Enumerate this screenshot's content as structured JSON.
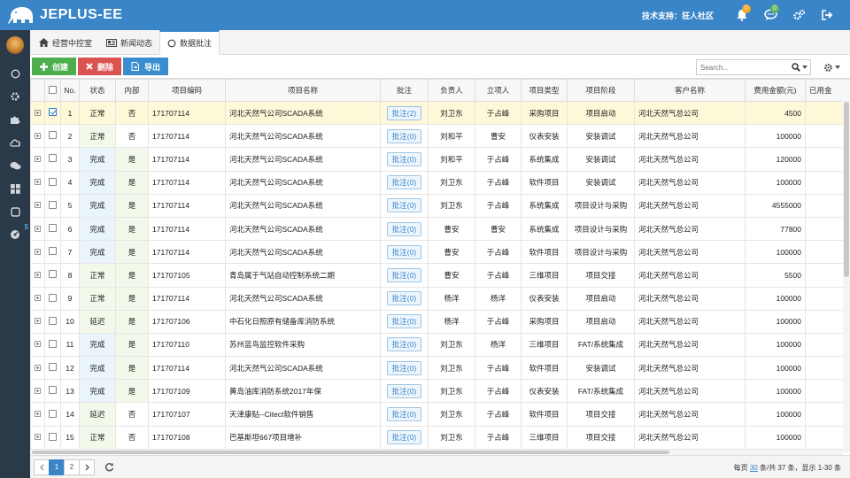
{
  "app": {
    "name": "JEPLUS-EE",
    "support": "技术支持：狂人社区"
  },
  "header": {
    "notify_count": "0",
    "message_count": "0"
  },
  "sidebar": {
    "badge": "5"
  },
  "tabs": [
    {
      "label": "经营中控室"
    },
    {
      "label": "新闻动态"
    },
    {
      "label": "数据批注"
    }
  ],
  "toolbar": {
    "create": "创建",
    "delete": "删除",
    "export": "导出",
    "search_placeholder": "Search..."
  },
  "columns": [
    "No.",
    "状态",
    "内部",
    "项目编码",
    "项目名称",
    "批注",
    "负责人",
    "立项人",
    "项目类型",
    "项目阶段",
    "客户名称",
    "费用金额(元)",
    "已用金"
  ],
  "rows": [
    {
      "no": "1",
      "status": "正常",
      "internal": "否",
      "code": "171707114",
      "name": "河北天然气公司SCADA系统",
      "note": "批注(2)",
      "owner": "刘卫东",
      "creator": "于占峰",
      "type": "采购项目",
      "stage": "项目启动",
      "customer": "河北天然气总公司",
      "amount": "4500"
    },
    {
      "no": "2",
      "status": "正常",
      "internal": "否",
      "code": "171707114",
      "name": "河北天然气公司SCADA系统",
      "note": "批注(0)",
      "owner": "刘和平",
      "creator": "曹安",
      "type": "仪表安装",
      "stage": "安装调试",
      "customer": "河北天然气总公司",
      "amount": "100000"
    },
    {
      "no": "3",
      "status": "完成",
      "internal": "是",
      "code": "171707114",
      "name": "河北天然气公司SCADA系统",
      "note": "批注(0)",
      "owner": "刘和平",
      "creator": "于占峰",
      "type": "系统集成",
      "stage": "安装调试",
      "customer": "河北天然气总公司",
      "amount": "120000"
    },
    {
      "no": "4",
      "status": "完成",
      "internal": "是",
      "code": "171707114",
      "name": "河北天然气公司SCADA系统",
      "note": "批注(0)",
      "owner": "刘卫东",
      "creator": "于占峰",
      "type": "软件项目",
      "stage": "安装调试",
      "customer": "河北天然气总公司",
      "amount": "100000"
    },
    {
      "no": "5",
      "status": "完成",
      "internal": "是",
      "code": "171707114",
      "name": "河北天然气公司SCADA系统",
      "note": "批注(0)",
      "owner": "刘卫东",
      "creator": "于占峰",
      "type": "系统集成",
      "stage": "项目设计与采购",
      "customer": "河北天然气总公司",
      "amount": "4555000"
    },
    {
      "no": "6",
      "status": "完成",
      "internal": "是",
      "code": "171707114",
      "name": "河北天然气公司SCADA系统",
      "note": "批注(0)",
      "owner": "曹安",
      "creator": "曹安",
      "type": "系统集成",
      "stage": "项目设计与采购",
      "customer": "河北天然气总公司",
      "amount": "77800"
    },
    {
      "no": "7",
      "status": "完成",
      "internal": "是",
      "code": "171707114",
      "name": "河北天然气公司SCADA系统",
      "note": "批注(0)",
      "owner": "曹安",
      "creator": "于占峰",
      "type": "软件项目",
      "stage": "项目设计与采购",
      "customer": "河北天然气总公司",
      "amount": "100000"
    },
    {
      "no": "8",
      "status": "正常",
      "internal": "是",
      "code": "171707105",
      "name": "青岛属于气站自动控制系统二期",
      "note": "批注(0)",
      "owner": "曹安",
      "creator": "于占峰",
      "type": "三维项目",
      "stage": "项目交接",
      "customer": "河北天然气总公司",
      "amount": "5500"
    },
    {
      "no": "9",
      "status": "正常",
      "internal": "是",
      "code": "171707114",
      "name": "河北天然气公司SCADA系统",
      "note": "批注(0)",
      "owner": "杨洋",
      "creator": "杨洋",
      "type": "仪表安装",
      "stage": "项目启动",
      "customer": "河北天然气总公司",
      "amount": "100000"
    },
    {
      "no": "10",
      "status": "延迟",
      "internal": "是",
      "code": "171707106",
      "name": "中石化日照原有储备库消防系统",
      "note": "批注(0)",
      "owner": "杨洋",
      "creator": "于占峰",
      "type": "采购项目",
      "stage": "项目启动",
      "customer": "河北天然气总公司",
      "amount": "100000"
    },
    {
      "no": "11",
      "status": "完成",
      "internal": "是",
      "code": "171707110",
      "name": "苏州蓝鸟监控软件采购",
      "note": "批注(0)",
      "owner": "刘卫东",
      "creator": "杨洋",
      "type": "三维项目",
      "stage": "FAT/系统集成",
      "customer": "河北天然气总公司",
      "amount": "100000"
    },
    {
      "no": "12",
      "status": "完成",
      "internal": "是",
      "code": "171707114",
      "name": "河北天然气公司SCADA系统",
      "note": "批注(0)",
      "owner": "刘卫东",
      "creator": "于占峰",
      "type": "软件项目",
      "stage": "安装调试",
      "customer": "河北天然气总公司",
      "amount": "100000"
    },
    {
      "no": "13",
      "status": "完成",
      "internal": "是",
      "code": "171707109",
      "name": "黄岛油库消防系统2017年保",
      "note": "批注(0)",
      "owner": "刘卫东",
      "creator": "于占峰",
      "type": "仪表安装",
      "stage": "FAT/系统集成",
      "customer": "河北天然气总公司",
      "amount": "100000"
    },
    {
      "no": "14",
      "status": "延迟",
      "internal": "否",
      "code": "171707107",
      "name": "天津康贴--Citect软件销售",
      "note": "批注(0)",
      "owner": "刘卫东",
      "creator": "于占峰",
      "type": "软件项目",
      "stage": "项目交接",
      "customer": "河北天然气总公司",
      "amount": "100000"
    },
    {
      "no": "15",
      "status": "正常",
      "internal": "否",
      "code": "171707108",
      "name": "巴基斯坦667项目增补",
      "note": "批注(0)",
      "owner": "刘卫东",
      "creator": "于占峰",
      "type": "三维项目",
      "stage": "项目交接",
      "customer": "河北天然气总公司",
      "amount": "100000"
    }
  ],
  "pager": {
    "pages": [
      "1",
      "2"
    ],
    "active": "1",
    "info_prefix": "每页",
    "page_size": "30",
    "info_suffix": "条/共 37 条，显示 1-30 条"
  }
}
